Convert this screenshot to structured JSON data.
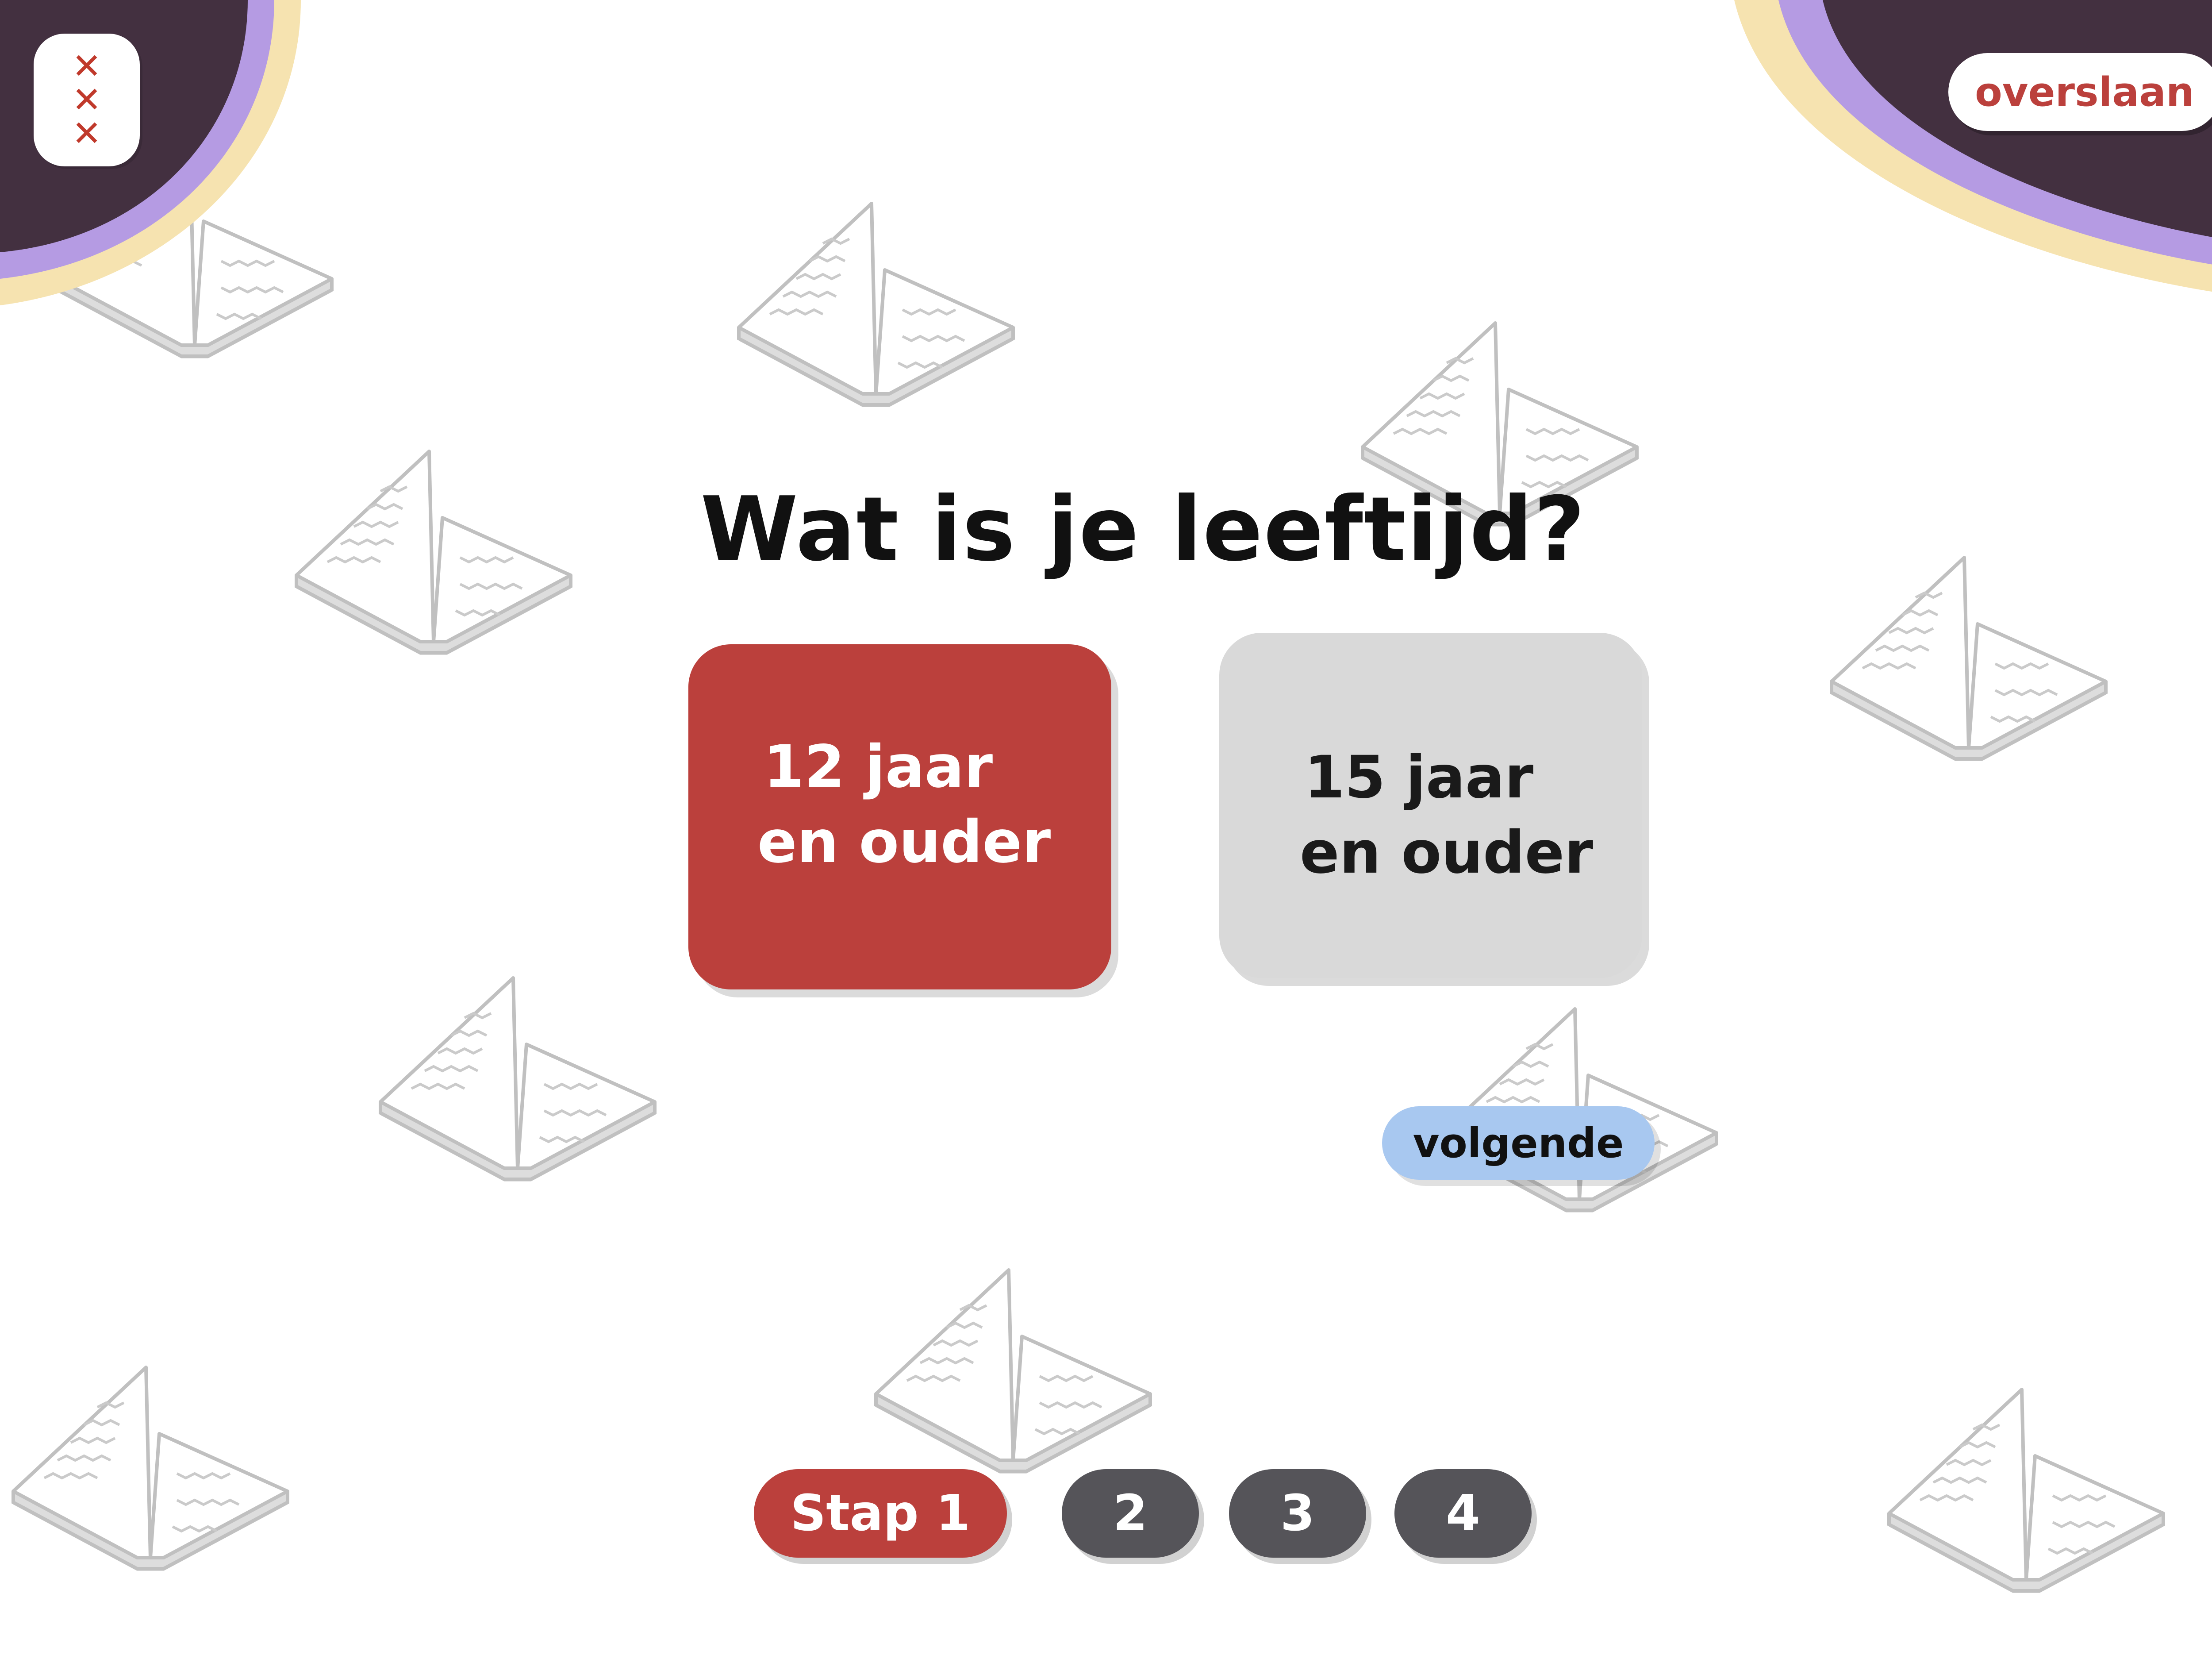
{
  "colors": {
    "accent_red": "#bb403c",
    "corner_dark": "#433040",
    "corner_lilac": "#b59be3",
    "corner_cream": "#f6e3b0",
    "option_grey": "#d9d9d9",
    "next_blue": "#a8c8f0",
    "step_grey": "#555459"
  },
  "header": {
    "logo_icon": "amsterdam-xxx-icon",
    "skip_label": "overslaan"
  },
  "question": "Wat is je leeftijd?",
  "options": [
    {
      "line1": "12 jaar",
      "line2": "en ouder",
      "selected": true
    },
    {
      "line1": "15 jaar",
      "line2": "en ouder",
      "selected": false
    }
  ],
  "next_label": "volgende",
  "steps": [
    {
      "label": "Stap 1",
      "active": true
    },
    {
      "label": "2",
      "active": false
    },
    {
      "label": "3",
      "active": false
    },
    {
      "label": "4",
      "active": false
    }
  ],
  "background_icon": "open-book-icon"
}
